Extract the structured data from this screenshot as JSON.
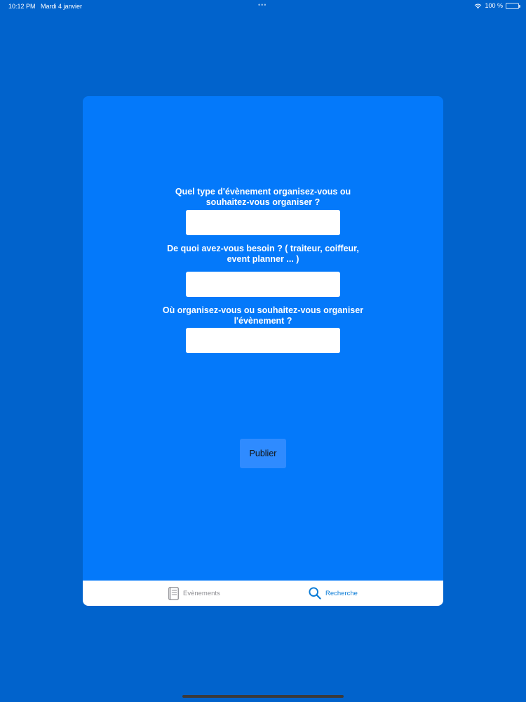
{
  "status_bar": {
    "time": "10:12 PM",
    "date": "Mardi 4 janvier",
    "dots": "•••",
    "battery": "100 %",
    "icons": [
      "wifi-icon",
      "battery-icon"
    ]
  },
  "form": {
    "questions": [
      {
        "label": "Quel type d'évènement organisez-vous ou souhaitez-vous organiser ?",
        "value": "",
        "placeholder": ""
      },
      {
        "label": "De quoi avez-vous besoin ? ( traiteur, coiffeur, event planner ... )",
        "value": "",
        "placeholder": ""
      },
      {
        "label": "Où organisez-vous ou souhaitez-vous organiser l'évènement ?",
        "value": "",
        "placeholder": ""
      }
    ],
    "publish_label": "Publier"
  },
  "tab_bar": {
    "tabs": [
      {
        "label": "Evènements",
        "icon": "list-book-icon",
        "selected": false
      },
      {
        "label": "Recherche",
        "icon": "search-icon",
        "selected": true
      }
    ]
  },
  "colors": {
    "background": "#0163cc",
    "card": "#0479fa",
    "button": "#2f8bff",
    "tab_active": "#0a7bd6",
    "tab_inactive": "#8e8e93"
  }
}
